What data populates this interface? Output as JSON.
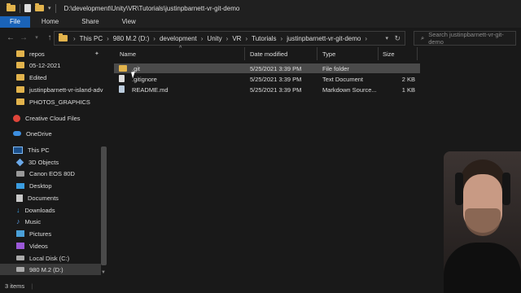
{
  "window": {
    "title": "D:\\development\\Unity\\VR\\Tutorials\\justinpbarnett-vr-git-demo"
  },
  "ribbon": {
    "tabs": [
      "File",
      "Home",
      "Share",
      "View"
    ]
  },
  "address": {
    "crumbs": [
      "This PC",
      "980 M.2 (D:)",
      "development",
      "Unity",
      "VR",
      "Tutorials",
      "justinpbarnett-vr-git-demo"
    ]
  },
  "search": {
    "placeholder": "Search justinpbarnett-vr-git-demo"
  },
  "sidebar": {
    "items": [
      {
        "label": "repos",
        "icon": "folder-icon"
      },
      {
        "label": "05-12-2021",
        "icon": "folder-icon"
      },
      {
        "label": "Edited",
        "icon": "folder-icon"
      },
      {
        "label": "justinpbarnett-vr-island-adv",
        "icon": "folder-icon"
      },
      {
        "label": "PHOTOS_GRAPHICS",
        "icon": "folder-icon"
      },
      {
        "label": "Creative Cloud Files",
        "icon": "creative-cloud-icon"
      },
      {
        "label": "OneDrive",
        "icon": "onedrive-icon"
      },
      {
        "label": "This PC",
        "icon": "this-pc-icon"
      },
      {
        "label": "3D Objects",
        "icon": "3d-objects-icon"
      },
      {
        "label": "Canon EOS 80D",
        "icon": "camera-icon"
      },
      {
        "label": "Desktop",
        "icon": "desktop-icon"
      },
      {
        "label": "Documents",
        "icon": "documents-icon"
      },
      {
        "label": "Downloads",
        "icon": "downloads-icon"
      },
      {
        "label": "Music",
        "icon": "music-icon"
      },
      {
        "label": "Pictures",
        "icon": "pictures-icon"
      },
      {
        "label": "Videos",
        "icon": "videos-icon"
      },
      {
        "label": "Local Disk (C:)",
        "icon": "disk-icon"
      },
      {
        "label": "980 M.2 (D:)",
        "icon": "disk-icon"
      }
    ]
  },
  "columns": {
    "name": "Name",
    "date": "Date modified",
    "type": "Type",
    "size": "Size"
  },
  "files": [
    {
      "name": ".git",
      "date": "5/25/2021 3:39 PM",
      "type": "File folder",
      "size": ""
    },
    {
      "name": ".gitignore",
      "date": "5/25/2021 3:39 PM",
      "type": "Text Document",
      "size": "2 KB"
    },
    {
      "name": "README.md",
      "date": "5/25/2021 3:39 PM",
      "type": "Markdown Source...",
      "size": "1 KB"
    }
  ],
  "status": {
    "count": "3 items"
  },
  "colors": {
    "accent": "#1a63b8",
    "folder": "#e2b34c",
    "background": "#191919"
  }
}
